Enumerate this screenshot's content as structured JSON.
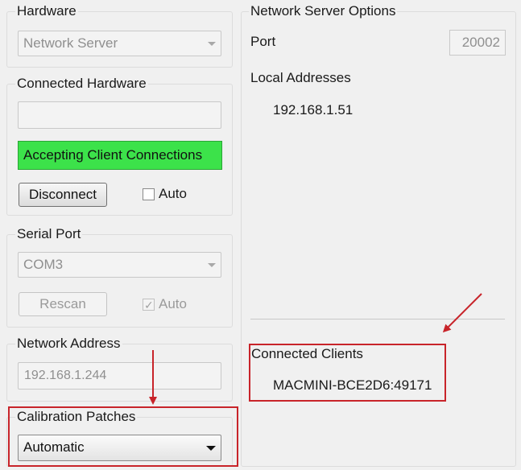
{
  "hardware": {
    "title": "Hardware",
    "selected": "Network Server"
  },
  "connected_hardware": {
    "title": "Connected Hardware",
    "name_value": "",
    "status": "Accepting Client Connections",
    "disconnect_label": "Disconnect",
    "auto_label": "Auto",
    "auto_checked": false
  },
  "serial_port": {
    "title": "Serial Port",
    "selected": "COM3",
    "rescan_label": "Rescan",
    "auto_label": "Auto",
    "auto_checked": true
  },
  "network_address": {
    "title": "Network Address",
    "value": "192.168.1.244"
  },
  "calibration_patches": {
    "title": "Calibration Patches",
    "selected": "Automatic"
  },
  "network_server_options": {
    "title": "Network Server Options",
    "port_label": "Port",
    "port_value": "20002",
    "local_addresses_label": "Local Addresses",
    "local_addresses": [
      "192.168.1.51"
    ],
    "connected_clients_label": "Connected Clients",
    "connected_clients": [
      "MACMINI-BCE2D6:49171"
    ]
  },
  "colors": {
    "status_green": "#3ce24a",
    "annotation_red": "#c8242a",
    "background": "#f0f0f0"
  }
}
